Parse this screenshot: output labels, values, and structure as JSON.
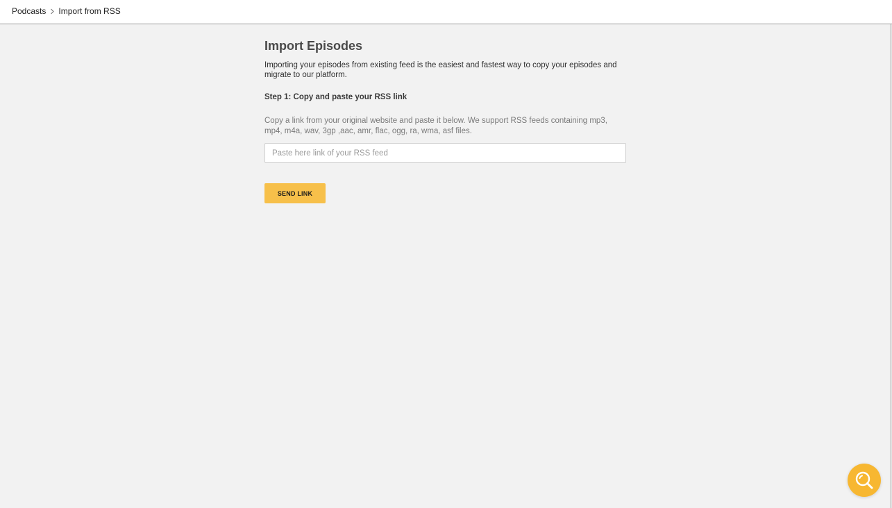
{
  "breadcrumb": {
    "items": [
      {
        "label": "Podcasts"
      },
      {
        "label": "Import from RSS"
      }
    ],
    "separator_icon": "chevron-right-icon"
  },
  "main": {
    "title": "Import Episodes",
    "intro": "Importing your episodes from existing feed is the easiest and fastest way to copy your episodes and migrate to our platform.",
    "step_title": "Step 1: Copy and paste your RSS link",
    "help_text": "Copy a link from your original website and paste it below. We support RSS feeds containing mp3, mp4, m4a, wav, 3gp ,aac, amr, flac, ogg, ra, wma, asf files.",
    "rss_input": {
      "value": "",
      "placeholder": "Paste here link of your RSS feed"
    },
    "send_button_label": "SEND LINK"
  },
  "help_widget": {
    "icon": "search-icon"
  },
  "colors": {
    "accent": "#f7c04a",
    "fab": "#f7b731",
    "background": "#f2f2f2"
  }
}
